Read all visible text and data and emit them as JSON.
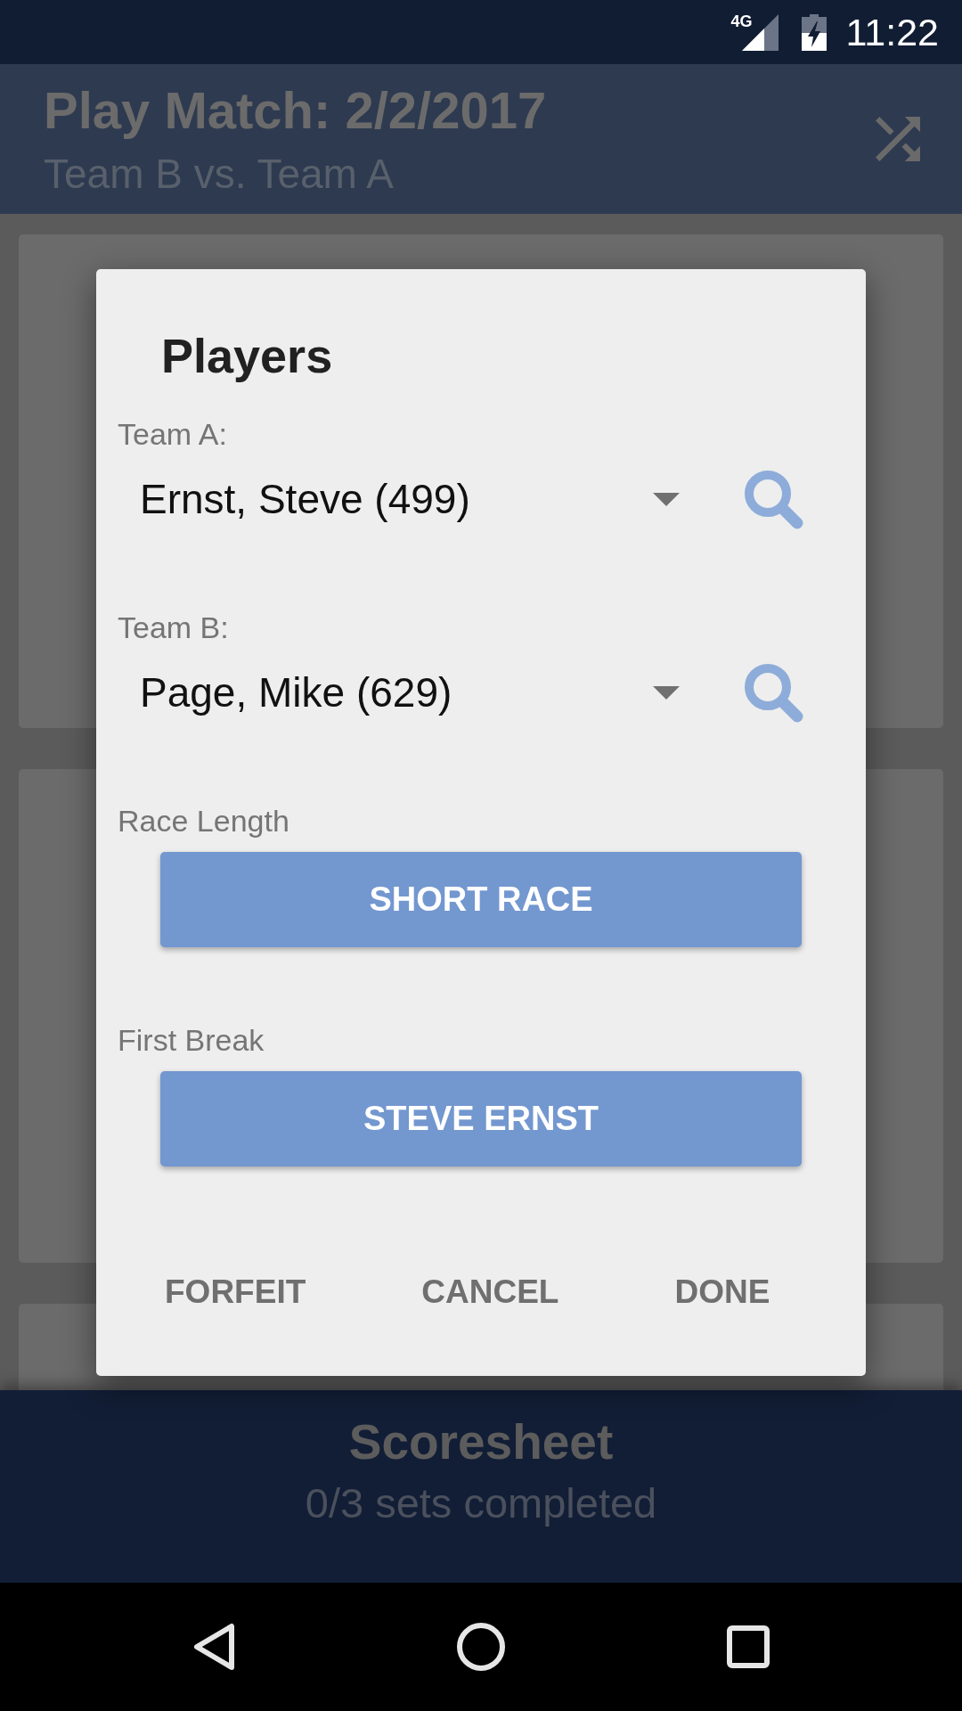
{
  "status_bar": {
    "network": "4G",
    "time": "11:22"
  },
  "app_bar": {
    "title": "Play Match: 2/2/2017",
    "subtitle": "Team B vs. Team A"
  },
  "dialog": {
    "title": "Players",
    "fields": [
      {
        "kind": "select",
        "label": "Team A:",
        "value": "Ernst, Steve (499)"
      },
      {
        "kind": "select",
        "label": "Team B:",
        "value": "Page, Mike (629)"
      },
      {
        "kind": "button",
        "label": "Race Length",
        "value": "SHORT RACE"
      },
      {
        "kind": "button",
        "label": "First Break",
        "value": "STEVE ERNST"
      }
    ],
    "actions": [
      "FORFEIT",
      "CANCEL",
      "DONE"
    ]
  },
  "bottom_bar": {
    "title": "Scoresheet",
    "subtitle": "0/3 sets completed"
  }
}
